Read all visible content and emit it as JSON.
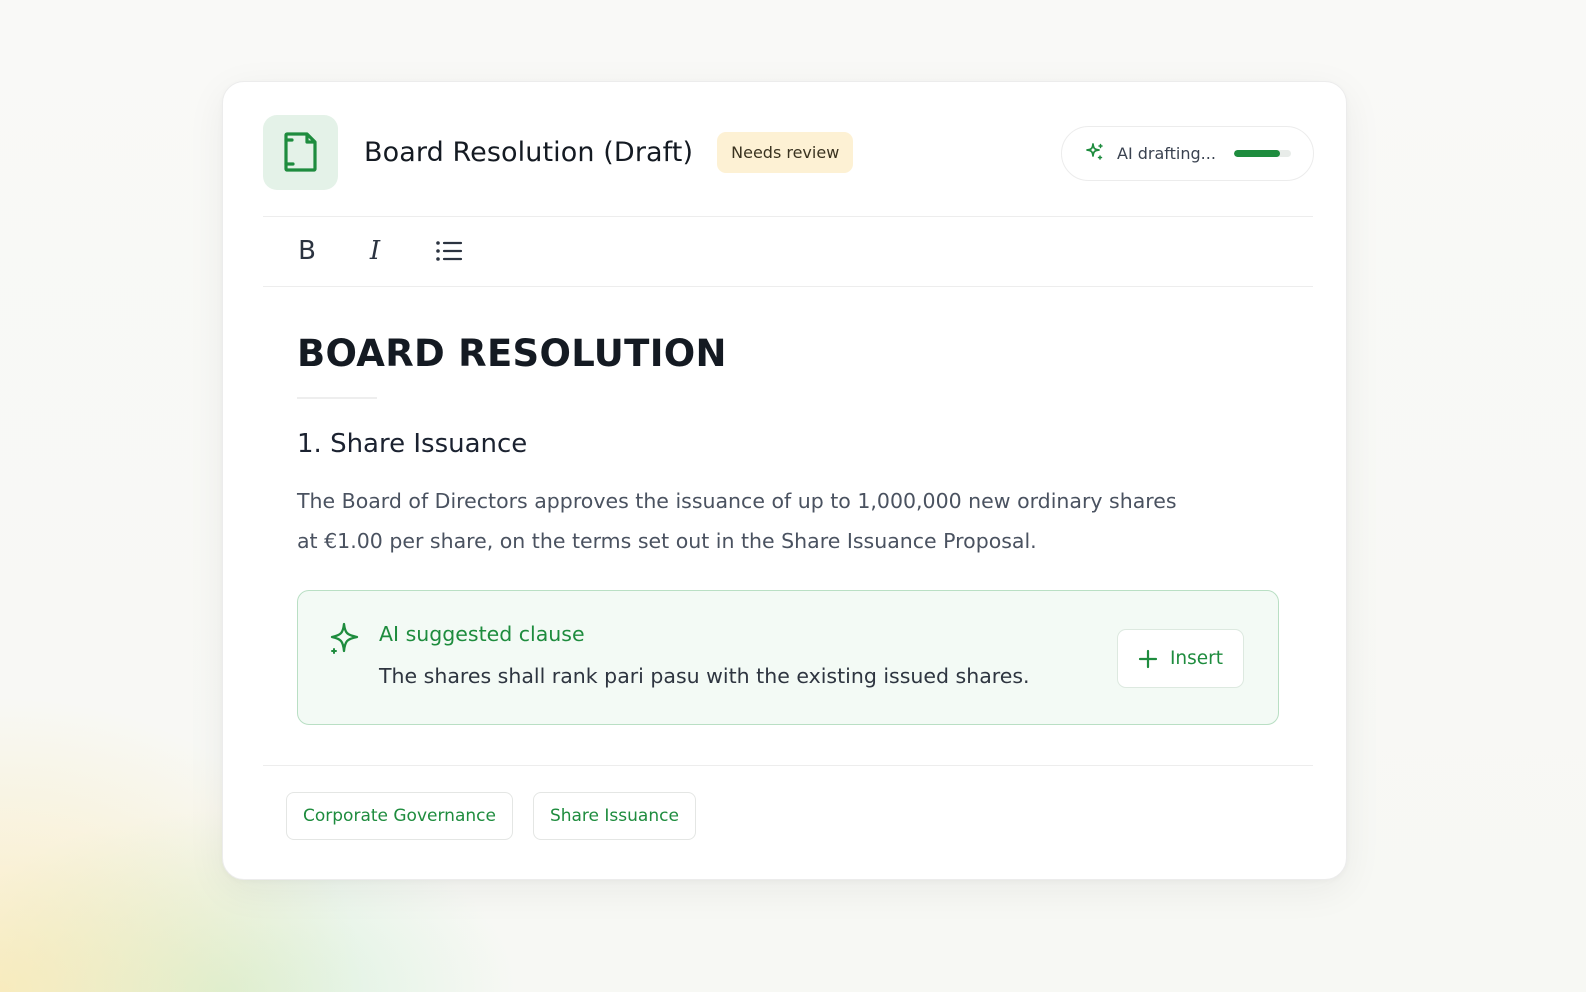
{
  "header": {
    "title": "Board Resolution (Draft)",
    "badge": "Needs review",
    "ai_status": {
      "label": "AI drafting...",
      "progress": 0.8
    }
  },
  "toolbar": {
    "bold": "B",
    "italic": "I",
    "list_icon": "bullet-list-icon"
  },
  "document": {
    "heading": "BOARD RESOLUTION",
    "section_title": "1. Share Issuance",
    "paragraph_line1": "The Board of Directors approves the issuance of up to 1,000,000 new ordinary shares",
    "paragraph_line2": "at €1.00 per share, on the terms set out in the Share Issuance Proposal."
  },
  "suggestion": {
    "title": "AI suggested clause",
    "text": "The shares shall rank pari pasu with the existing issued shares.",
    "insert_label": "Insert"
  },
  "tags": [
    "Corporate Governance",
    "Share Issuance"
  ],
  "colors": {
    "accent": "#1e8c3e",
    "badge_bg": "#fdf1d4",
    "suggestion_bg": "#f3faf5",
    "suggestion_border": "#b9dfc4"
  }
}
